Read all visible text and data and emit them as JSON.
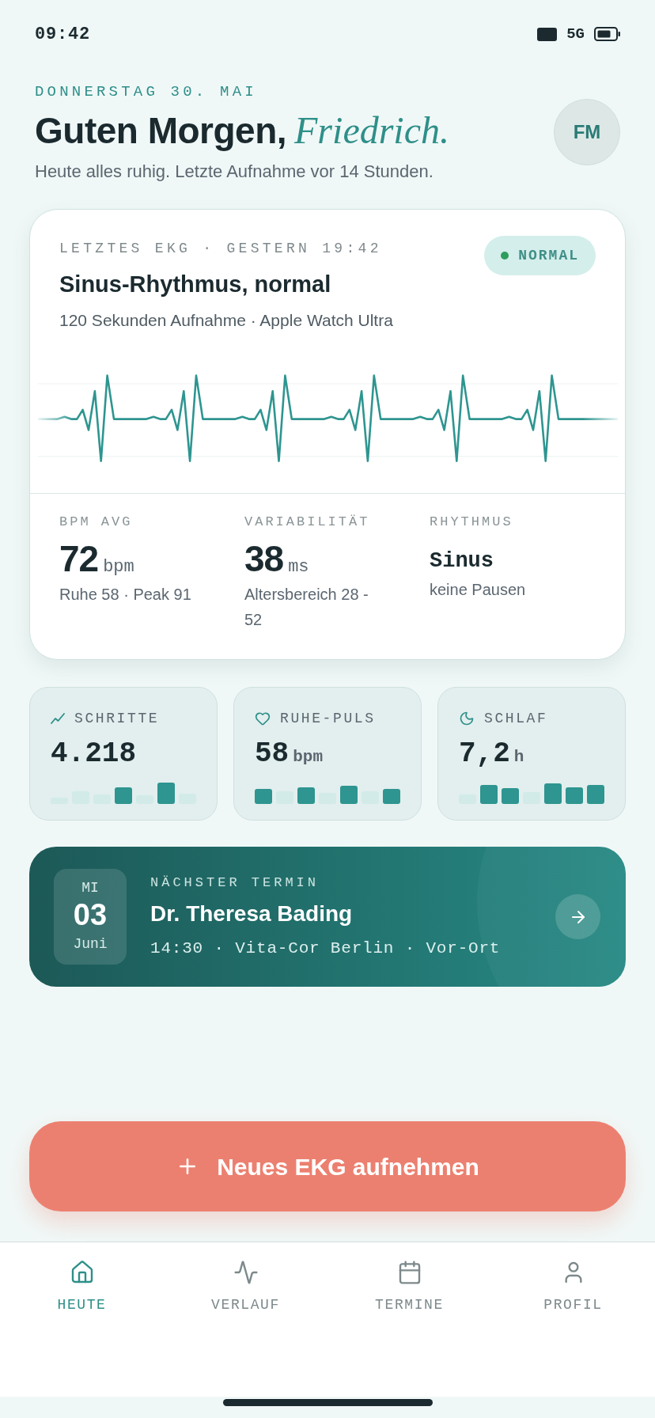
{
  "status_bar": {
    "time": "09:42",
    "network": "5G"
  },
  "header": {
    "date": "DONNERSTAG 30. MAI",
    "greeting": "Guten Morgen,",
    "name": "Friedrich.",
    "subtitle": "Heute alles ruhig. Letzte Aufnahme vor 14 Stunden.",
    "avatar": "FM"
  },
  "ecg_card": {
    "label": "LETZTES EKG · GESTERN 19:42",
    "badge": "NORMAL",
    "title": "Sinus-Rhythmus, normal",
    "subtitle": "120 Sekunden Aufnahme · Apple Watch Ultra",
    "stats": [
      {
        "kind": "number",
        "label": "BPM AVG",
        "value": "72",
        "unit": "bpm",
        "detail": "Ruhe 58 · Peak 91"
      },
      {
        "kind": "number",
        "label": "VARIABILITÄT",
        "value": "38",
        "unit": "ms",
        "detail": "Altersbereich 28 - 52"
      },
      {
        "kind": "word",
        "label": "RHYTHMUS",
        "value": "Sinus",
        "detail": "keine Pausen"
      }
    ]
  },
  "metrics": [
    {
      "label": "SCHRITTE",
      "value": "4.218"
    },
    {
      "label": "RUHE-PULS",
      "value": "58",
      "unit": "bpm"
    },
    {
      "label": "SCHLAF",
      "value": "7,2",
      "unit": "h"
    }
  ],
  "appointment": {
    "label": "NÄCHSTER TERMIN",
    "weekday": "MI",
    "day": "03",
    "month": "Juni",
    "doctor": "Dr. Theresa Bading",
    "details": "14:30 · Vita-Cor Berlin · Vor-Ort"
  },
  "action_button": {
    "label": "Neues EKG aufnehmen"
  },
  "tab_bar": [
    {
      "label": "HEUTE",
      "selected": true
    },
    {
      "label": "VERLAUF",
      "selected": false
    },
    {
      "label": "TERMINE",
      "selected": false
    },
    {
      "label": "PROFIL",
      "selected": false
    }
  ]
}
